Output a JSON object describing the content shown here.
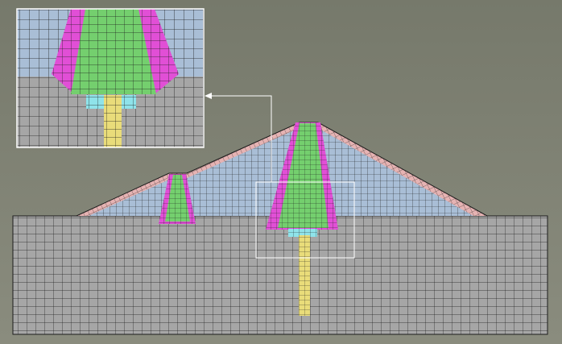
{
  "figure": {
    "background_top": "#76796b",
    "background_bottom": "#8a8c7e",
    "mesh_line_color": "#1c1c1c",
    "callout_color": "#ffffff"
  },
  "materials": {
    "foundation": "#a6a6a6",
    "dam_shell": "#a9bed6",
    "slope_protection": "#e6b3b3",
    "filter_zone": "#e14fd6",
    "core": "#74cf6e",
    "cutoff_wall": "#e9dc7a",
    "grout_cap": "#8fe3ea"
  }
}
